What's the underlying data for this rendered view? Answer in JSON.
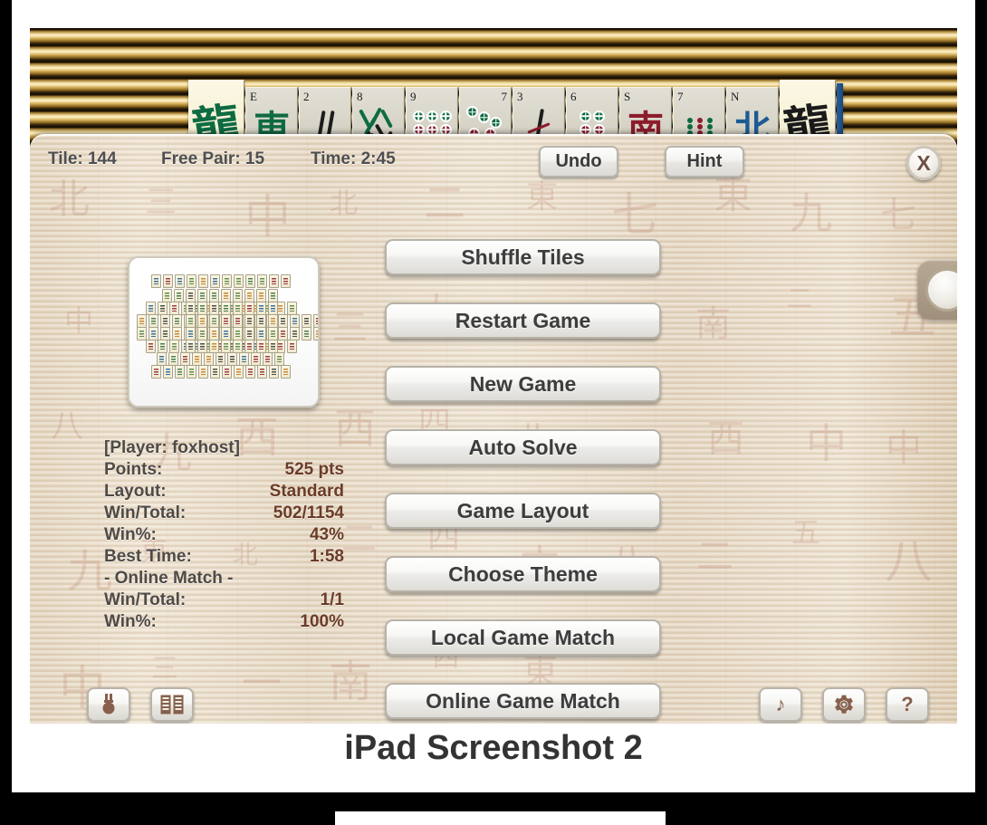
{
  "caption": "iPad Screenshot 2",
  "status": {
    "tile": "Tile: 144",
    "free_pair": "Free Pair: 15",
    "time": "Time: 2:45"
  },
  "top_buttons": {
    "undo": "Undo",
    "hint": "Hint",
    "close_icon": "X"
  },
  "menu": {
    "buttons": [
      {
        "label": "Shuffle Tiles"
      },
      {
        "label": "Restart Game"
      },
      {
        "label": "New Game"
      },
      {
        "label": "Auto Solve"
      },
      {
        "label": "Game Layout"
      },
      {
        "label": "Choose Theme"
      },
      {
        "label": "Local Game Match"
      },
      {
        "label": "Online Game Match"
      }
    ]
  },
  "stats": {
    "player": "[Player: foxhost]",
    "rows": [
      {
        "label": "Points:",
        "value": "525 pts"
      },
      {
        "label": "Layout:",
        "value": "Standard"
      },
      {
        "label": "Win/Total:",
        "value": "502/1154"
      },
      {
        "label": "Win%:",
        "value": "43%"
      },
      {
        "label": "Best Time:",
        "value": "1:58"
      }
    ],
    "online_header": "- Online Match -",
    "online_rows": [
      {
        "label": "Win/Total:",
        "value": "1/1"
      },
      {
        "label": "Win%:",
        "value": "100%"
      }
    ]
  },
  "icon_buttons": {
    "medal": "♕",
    "book": "≡",
    "music": "♪",
    "gear": "⚙",
    "help": "?"
  },
  "tiles": [
    {
      "corner": "",
      "corner_pos": "tl",
      "kind": "dragon",
      "glyph": "龍",
      "color": "#0d6b42",
      "cream": true
    },
    {
      "corner": "E",
      "corner_pos": "tl",
      "kind": "wind",
      "glyph": "東",
      "color": "#0d6b42",
      "cream": false
    },
    {
      "corner": "2",
      "corner_pos": "tl",
      "kind": "bamboo2",
      "glyph": "",
      "color": "#1d1d1d",
      "cream": false
    },
    {
      "corner": "8",
      "corner_pos": "tl",
      "kind": "bamboo8",
      "glyph": "",
      "color": "#0d6b42",
      "cream": false
    },
    {
      "corner": "9",
      "corner_pos": "tl",
      "kind": "dots9",
      "glyph": "",
      "color": "#0d6b42",
      "cream": false
    },
    {
      "corner": "7",
      "corner_pos": "tr",
      "kind": "dots7",
      "glyph": "",
      "color": "#0d6b42",
      "cream": false
    },
    {
      "corner": "3",
      "corner_pos": "tl",
      "kind": "bamboo3",
      "glyph": "",
      "color": "#1d1d1d",
      "cream": false
    },
    {
      "corner": "6",
      "corner_pos": "tl",
      "kind": "dots6",
      "glyph": "",
      "color": "#0d6b42",
      "cream": false
    },
    {
      "corner": "S",
      "corner_pos": "tl",
      "kind": "wind",
      "glyph": "南",
      "color": "#8c1c2c",
      "cream": false
    },
    {
      "corner": "7",
      "corner_pos": "tl",
      "kind": "bamboo7",
      "glyph": "",
      "color": "#0d6b42",
      "cream": false
    },
    {
      "corner": "N",
      "corner_pos": "tl",
      "kind": "wind",
      "glyph": "北",
      "color": "#1d5b94",
      "cream": false
    },
    {
      "corner": "",
      "corner_pos": "tl",
      "kind": "dragon",
      "glyph": "龍",
      "color": "#1a1a1a",
      "cream": true
    }
  ],
  "colors": {
    "panel_wood": "#e6d8c2",
    "mat_gold": "#b8913f",
    "stat_label": "#4e4a47",
    "stat_value": "#6b3c28",
    "button_text": "#3d3d3d",
    "icon_brown": "#86604c",
    "caption_text": "#333333"
  }
}
